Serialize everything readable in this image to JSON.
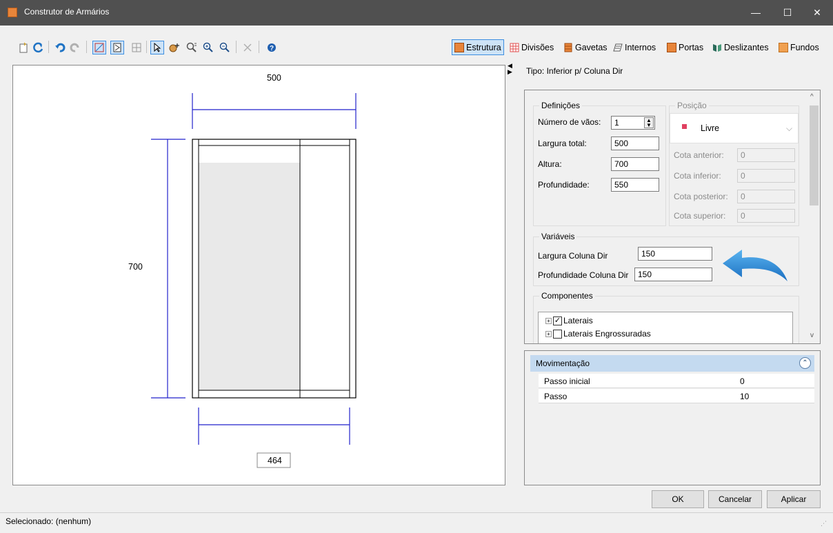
{
  "window": {
    "title": "Construtor de Armários",
    "minimize": "—",
    "maximize": "☐",
    "close": "✕"
  },
  "tabs": [
    {
      "label": "Estrutura",
      "color": "#e8853a"
    },
    {
      "label": "Divisões",
      "color": "#e8853a"
    },
    {
      "label": "Gavetas",
      "color": "#e8853a"
    },
    {
      "label": "Internos",
      "color": "#555555"
    },
    {
      "label": "Portas",
      "color": "#e8853a"
    },
    {
      "label": "Deslizantes",
      "color": "#2a6a5a"
    },
    {
      "label": "Fundos",
      "color": "#f0a050"
    }
  ],
  "canvas": {
    "width_top": "500",
    "height_left": "700",
    "width_bottom": "464"
  },
  "tipo": "Tipo: Inferior p/ Coluna Dir",
  "definicoes": {
    "title": "Definições",
    "num_vaos_label": "Número de vãos:",
    "num_vaos_value": "1",
    "largura_label": "Largura total:",
    "largura_value": "500",
    "altura_label": "Altura:",
    "altura_value": "700",
    "profundidade_label": "Profundidade:",
    "profundidade_value": "550"
  },
  "posicao": {
    "title": "Posição",
    "selected": "Livre",
    "cota_anterior_label": "Cota anterior:",
    "cota_anterior_value": "0",
    "cota_inferior_label": "Cota inferior:",
    "cota_inferior_value": "0",
    "cota_posterior_label": "Cota posterior:",
    "cota_posterior_value": "0",
    "cota_superior_label": "Cota superior:",
    "cota_superior_value": "0"
  },
  "variaveis": {
    "title": "Variáveis",
    "largura_coluna_label": "Largura Coluna Dir",
    "largura_coluna_value": "150",
    "profundidade_coluna_label": "Profundidade Coluna Dir",
    "profundidade_coluna_value": "150"
  },
  "componentes": {
    "title": "Componentes",
    "items": [
      {
        "label": "Laterais",
        "checked": true
      },
      {
        "label": "Laterais Engrossuradas",
        "checked": false
      }
    ]
  },
  "movimentacao": {
    "title": "Movimentação",
    "rows": [
      {
        "label": "Passo inicial",
        "value": "0"
      },
      {
        "label": "Passo",
        "value": "10"
      }
    ]
  },
  "buttons": {
    "ok": "OK",
    "cancel": "Cancelar",
    "apply": "Aplicar"
  },
  "status": "Selecionado: (nenhum)",
  "colors": {
    "accent_blue": "#1f73c4",
    "dim_line": "#2222cc",
    "title_bar": "#505050"
  }
}
